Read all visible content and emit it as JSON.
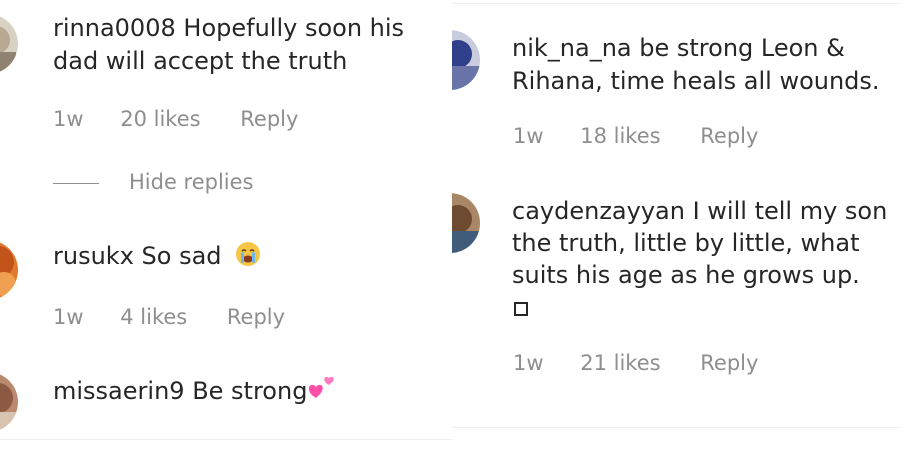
{
  "left_panel": {
    "comments": [
      {
        "username": "rinna0008",
        "text": "Hopefully soon his",
        "text_line2": "dad will accept the truth",
        "time": "1w",
        "likes": "20 likes",
        "reply": "Reply",
        "avatar_icon": "avatar-photo"
      },
      {
        "username": "rusukx",
        "text": "So sad",
        "emoji": "crying-face-emoji",
        "time": "1w",
        "likes": "4 likes",
        "reply": "Reply",
        "avatar_icon": "avatar-photo"
      },
      {
        "username": "missaerin9",
        "text": "Be strong",
        "emoji": "two-hearts-emoji",
        "avatar_icon": "avatar-photo"
      }
    ],
    "hide_replies_label": "Hide replies"
  },
  "right_panel": {
    "comments": [
      {
        "username": "nik_na_na",
        "text": "be strong Leon &",
        "text_line2": "Rihana, time heals all wounds.",
        "time": "1w",
        "likes": "18 likes",
        "reply": "Reply",
        "avatar_icon": "avatar-photo"
      },
      {
        "username": "caydenzayyan",
        "text": "I will tell my son",
        "text_line2": "the truth, little by little, what",
        "text_line3": "suits his age as he grows up.",
        "time": "1w",
        "likes": "21 likes",
        "reply": "Reply",
        "avatar_icon": "avatar-photo"
      }
    ]
  },
  "colors": {
    "text": "#262626",
    "meta": "#8e8e8e",
    "divider": "#eeeeee",
    "heart_pink": "#ff4fa8"
  }
}
